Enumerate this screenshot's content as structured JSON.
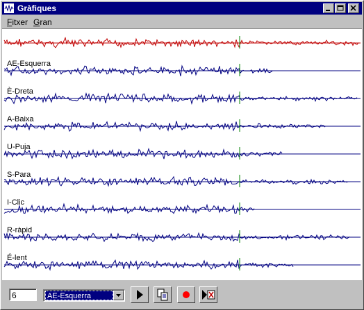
{
  "window": {
    "title": "Gràfiques"
  },
  "menu": {
    "items": [
      {
        "label": "Fitxer",
        "accel": "F",
        "rest": "itxer"
      },
      {
        "label": "Gran",
        "accel": "G",
        "rest": "ran"
      }
    ]
  },
  "tracks": [
    {
      "label": "",
      "color": "#c00000",
      "end_fraction": 1.0,
      "seed": 7
    },
    {
      "label": "AE-Esquerra",
      "color": "#000080",
      "end_fraction": 0.75,
      "seed": 11
    },
    {
      "label": "È-Dreta",
      "color": "#000080",
      "end_fraction": 0.99,
      "seed": 19
    },
    {
      "label": "A-Baixa",
      "color": "#000080",
      "end_fraction": 0.9,
      "seed": 23
    },
    {
      "label": "U-Puja",
      "color": "#000080",
      "end_fraction": 0.78,
      "seed": 29
    },
    {
      "label": "S-Para",
      "color": "#000080",
      "end_fraction": 0.96,
      "seed": 31
    },
    {
      "label": "I-Clic",
      "color": "#000080",
      "end_fraction": 0.7,
      "seed": 37
    },
    {
      "label": "R-ràpid",
      "color": "#000080",
      "end_fraction": 0.97,
      "seed": 41
    },
    {
      "label": "É-lent",
      "color": "#000080",
      "end_fraction": 0.81,
      "seed": 43
    }
  ],
  "marker_color": "#008000",
  "bottom": {
    "number_value": "6",
    "selected_option": "AE-Esquerra"
  },
  "buttons": {
    "play": "play-icon",
    "copy": "copy-icon",
    "record": "record-icon",
    "stop": "stop-icon"
  }
}
